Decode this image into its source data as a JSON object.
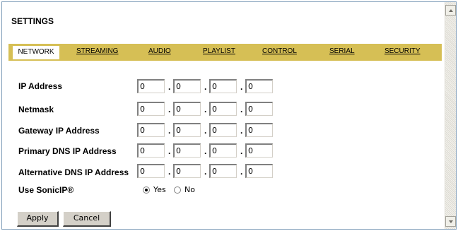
{
  "page": {
    "title": "SETTINGS"
  },
  "tabs": [
    {
      "label": "NETWORK",
      "active": true
    },
    {
      "label": "STREAMING",
      "active": false
    },
    {
      "label": "AUDIO",
      "active": false
    },
    {
      "label": "PLAYLIST",
      "active": false
    },
    {
      "label": "CONTROL",
      "active": false
    },
    {
      "label": "SERIAL",
      "active": false
    },
    {
      "label": "SECURITY",
      "active": false
    }
  ],
  "form": {
    "ip_address": {
      "label": "IP Address",
      "octets": [
        "0",
        "0",
        "0",
        "0"
      ]
    },
    "netmask": {
      "label": "Netmask",
      "octets": [
        "0",
        "0",
        "0",
        "0"
      ]
    },
    "gateway": {
      "label": "Gateway IP Address",
      "octets": [
        "0",
        "0",
        "0",
        "0"
      ]
    },
    "primary_dns": {
      "label": "Primary DNS IP Address",
      "octets": [
        "0",
        "0",
        "0",
        "0"
      ]
    },
    "alt_dns": {
      "label": "Alternative DNS IP Address",
      "octets": [
        "0",
        "0",
        "0",
        "0"
      ]
    },
    "dot": ".",
    "sonicip": {
      "label": "Use SonicIP®",
      "selected": "Yes",
      "options": [
        "Yes",
        "No"
      ]
    }
  },
  "buttons": {
    "apply": "Apply",
    "cancel": "Cancel"
  },
  "colors": {
    "tab_bar": "#d6bf55",
    "frame_border": "#7f9db9",
    "button_face": "#d4d0c8"
  },
  "icons": {
    "scroll_up": "triangle-up-icon",
    "scroll_down": "triangle-down-icon"
  }
}
